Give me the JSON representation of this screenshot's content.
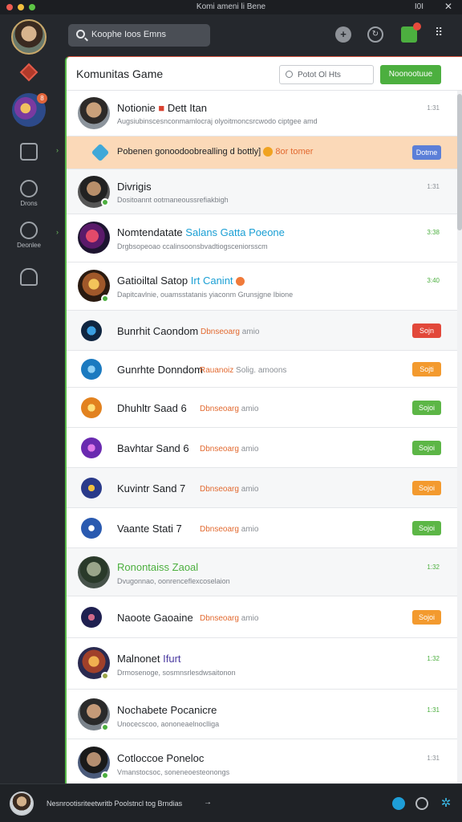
{
  "window": {
    "title": "Komi ameni li Bene",
    "right_text": "I0I",
    "close_glyph": "✕"
  },
  "header": {
    "search_text": "Koophe Ioos Emns",
    "icons": [
      "gamepad-icon",
      "refresh-icon",
      "notifications-icon",
      "more-icon"
    ],
    "more_glyph": "⠿"
  },
  "rail": {
    "items": [
      {
        "icon": "gem-icon",
        "label": ""
      },
      {
        "icon": "game-icon",
        "label": "",
        "badge": "8"
      },
      {
        "icon": "shield-icon",
        "label": ""
      },
      {
        "icon": "headset-icon",
        "label": "Drons"
      },
      {
        "icon": "clock-icon",
        "label": "Deonlee"
      },
      {
        "icon": "person-icon",
        "label": ""
      }
    ]
  },
  "panel": {
    "title": "Komunitas Game",
    "search_placeholder": "Potot Ol Hts",
    "action_button": "Noonootuue"
  },
  "rows": [
    {
      "name": "Notionie",
      "name_accent": "Dett Itan",
      "sub": "Augsiubinscesnconmamlocraj olyoitmoncsrcwodo ciptgee amd",
      "meta": "1:31"
    },
    {
      "promo": "Pobenen gonoodoobrealling d bottly]",
      "promo_tag": "8or tomer",
      "pill": "Dotme"
    },
    {
      "name": "Divrigis",
      "sub": "Dositoannt ootmaneoussrefiakbigh",
      "meta": "1:31"
    },
    {
      "name": "Nomtendatate",
      "name_accent": "Salans Gatta Poeone",
      "sub": "Drgbsopeoao ccalinsoonsbvadtiogsceniorsscm",
      "meta": "3:38"
    },
    {
      "name": "Gatioiltal Satop",
      "name_accent": "Irt Canint",
      "sub": "Dapitcavlnie, ouamsstatanis yiaconm Grunsjgne Ibione",
      "meta": "3:40"
    },
    {
      "name": "Bunrhit Caondom",
      "tag": "Dbnseoarg",
      "tag_sub": "amio",
      "pill": "Sojn"
    },
    {
      "name": "Gunrhte Donndom",
      "tag": "Rauanoiz",
      "tag_sub": "Solig. amoons",
      "pill": "Sojti"
    },
    {
      "name": "Dhuhltr Saad 6",
      "tag": "Dbnseoarg",
      "tag_sub": "amio",
      "pill": "Sojoi"
    },
    {
      "name": "Bavhtar Sand 6",
      "tag": "Dbnseoarg",
      "tag_sub": "amio",
      "pill": "Sojoi"
    },
    {
      "name": "Kuvintr Sand 7",
      "tag": "Dbnseoarg",
      "tag_sub": "amio",
      "pill": "Sojoi"
    },
    {
      "name": "Vaante Stati 7",
      "tag": "Dbnseoarg",
      "tag_sub": "amio",
      "pill": "Sojoi"
    },
    {
      "name": "Ronontaiss Zaoal",
      "sub": "Dvugonnao, oonrenceflexcoselaion",
      "meta": "1:32"
    },
    {
      "name": "Naoote Gaoaine",
      "tag": "Dbnseoarg",
      "tag_sub": "amio",
      "pill": "Sojoi"
    },
    {
      "name": "Malnonet",
      "name_accent": "Ifurt",
      "sub": "Drmosenoge, sosmnsrlesdwsaitonon",
      "meta": "1:32"
    },
    {
      "name": "Nochabete Pocanicre",
      "sub": "Unocecscoo, aononeaelnoclliga",
      "meta": "1:31"
    },
    {
      "name": "Cotloccoe Poneloc",
      "sub": "Vmanstocsoc, soneneoesteonongs",
      "meta": "1:31"
    }
  ],
  "bottom": {
    "text": "Nesnrootisriteetwritb Poolstncl tog Brndias",
    "arrow": "→",
    "icons": [
      "chat-icon",
      "emoji-icon",
      "settings-icon"
    ]
  }
}
